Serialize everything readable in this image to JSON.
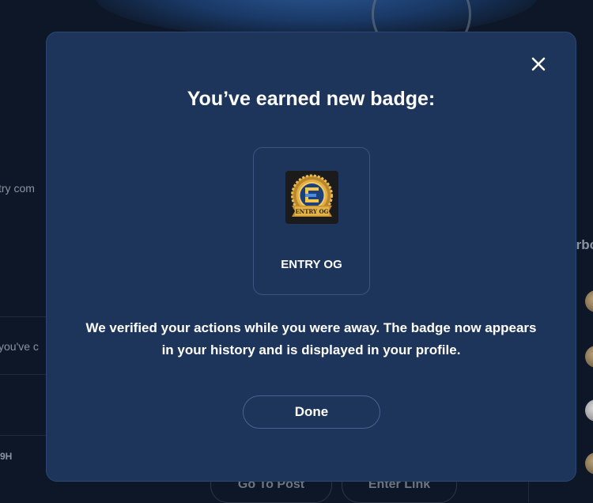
{
  "background": {
    "left_texts": [
      "try com",
      "you've c",
      "9H"
    ],
    "right_title": "rbo",
    "buttons": [
      "Go To Post",
      "Enter Link"
    ]
  },
  "modal": {
    "title": "You’ve earned new badge:",
    "badge": {
      "name": "ENTRY OG",
      "image_text": "ENTRY OG",
      "image_letter": "E"
    },
    "description": "We verified your actions while you were away. The badge now appears in your history and is displayed in your profile.",
    "done_label": "Done",
    "close_icon": "close-icon"
  },
  "colors": {
    "page_bg": "#0d1727",
    "modal_bg": "#1d355a",
    "badge_gold": "#d6a33a",
    "badge_blue": "#2c6cc4"
  }
}
